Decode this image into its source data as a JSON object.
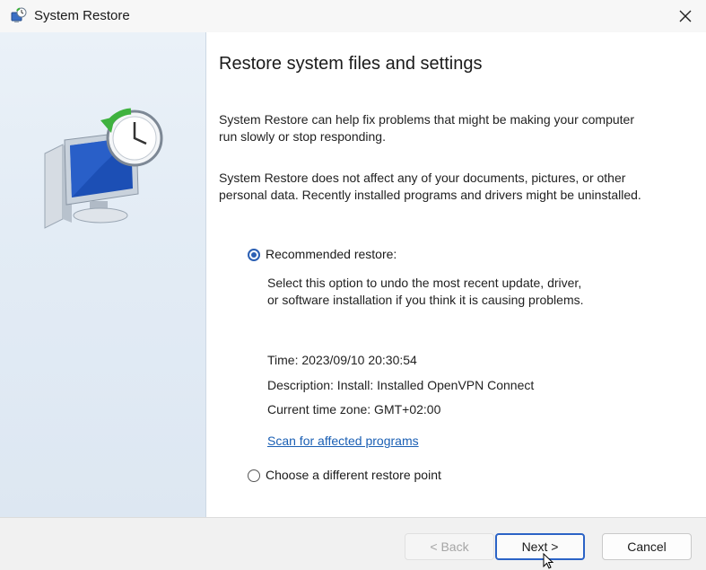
{
  "window": {
    "title": "System Restore"
  },
  "main": {
    "heading": "Restore system files and settings",
    "paragraph1": "System Restore can help fix problems that might be making your computer run slowly or stop responding.",
    "paragraph2": "System Restore does not affect any of your documents, pictures, or other personal data. Recently installed programs and drivers might be uninstalled.",
    "recommended": {
      "label": "Recommended restore:",
      "selected": true,
      "description_line1": "Select this option to undo the most recent update, driver,",
      "description_line2": "or software installation if you think it is causing problems.",
      "time": "Time: 2023/09/10 20:30:54",
      "description": "Description: Install: Installed OpenVPN Connect",
      "timezone": "Current time zone: GMT+02:00",
      "scan_link": "Scan for affected programs"
    },
    "different": {
      "label": "Choose a different restore point",
      "selected": false
    }
  },
  "footer": {
    "back_label": "< Back",
    "next_label": "Next >",
    "cancel_label": "Cancel"
  },
  "icons": {
    "title_icon": "system-restore-icon",
    "close_icon": "close-icon",
    "hero_icon": "computer-clock-restore-icon"
  },
  "colors": {
    "accent": "#2b5fb3",
    "link": "#1a5fb4",
    "sidebar": "#e3ecf5"
  }
}
